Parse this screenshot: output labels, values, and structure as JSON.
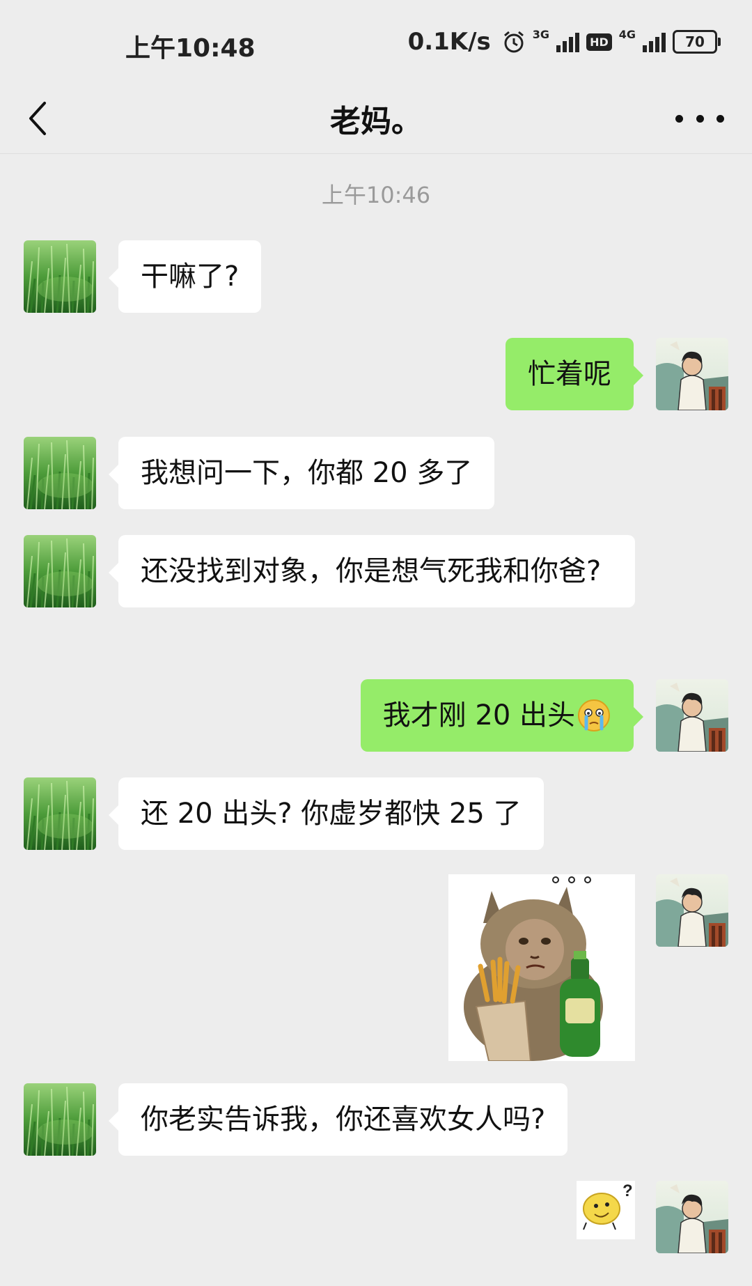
{
  "status_bar": {
    "time": "上午10:48",
    "net_speed": "0.1K/s",
    "sim1": "3G",
    "hd": "HD",
    "sim2": "4G",
    "battery": "70"
  },
  "nav": {
    "title": "老妈。"
  },
  "chat": {
    "timestamp": "上午10:46",
    "messages": [
      {
        "side": "left",
        "text": "干嘛了?"
      },
      {
        "side": "right",
        "text": "忙着呢"
      },
      {
        "side": "left",
        "text": "我想问一下，你都 20 多了"
      },
      {
        "side": "left",
        "text": "还没找到对象，你是想气死我和你爸?"
      },
      {
        "side": "right",
        "text": "我才刚 20 出头"
      },
      {
        "side": "left",
        "text": "还 20 出头? 你虚岁都快 25 了"
      },
      {
        "side": "right",
        "sticker": "cat-beer-fries-sticker"
      },
      {
        "side": "left",
        "text": "你老实告诉我，你还喜欢女人吗?"
      },
      {
        "side": "right",
        "sticker": "confused-face-sticker"
      }
    ]
  },
  "colors": {
    "background": "#ededed",
    "bubble_in": "#ffffff",
    "bubble_out": "#95ec69",
    "timestamp": "#9a9a9a"
  },
  "icons": {
    "back": "chevron-left-icon",
    "more": "more-dots-icon",
    "crying_emoji": "crying-face-emoji"
  }
}
